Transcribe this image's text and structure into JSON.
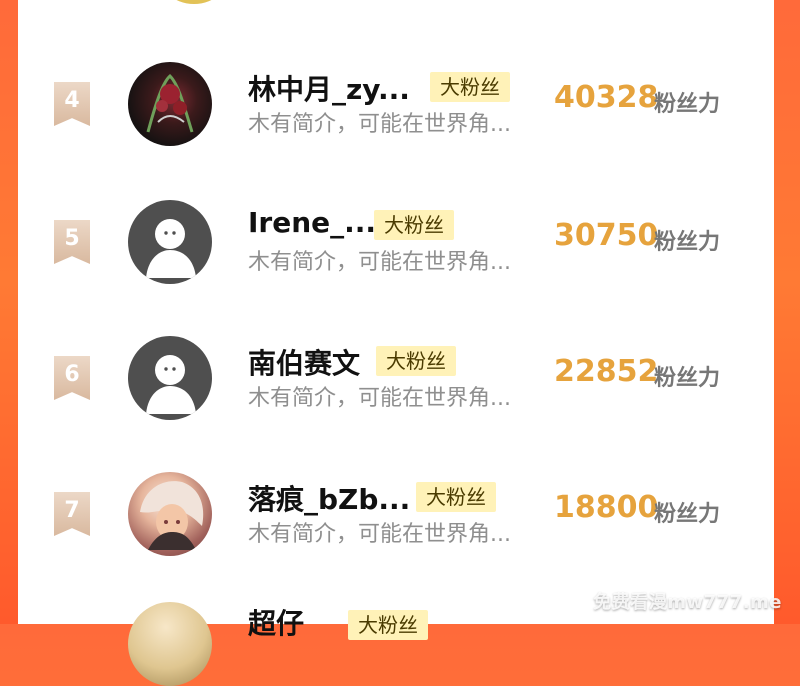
{
  "list": {
    "rows": [
      {
        "rank": "4",
        "name": "林中月_zy...",
        "badge": "大粉丝",
        "desc": "木有简介，可能在世界角...",
        "score": "40328",
        "unit": "粉丝力",
        "avatar_icon": "custom-avatar"
      },
      {
        "rank": "5",
        "name": "Irene_...",
        "badge": "大粉丝",
        "desc": "木有简介，可能在世界角...",
        "score": "30750",
        "unit": "粉丝力",
        "avatar_icon": "default-avatar-icon"
      },
      {
        "rank": "6",
        "name": "南伯赛文",
        "badge": "大粉丝",
        "desc": "木有简介，可能在世界角...",
        "score": "22852",
        "unit": "粉丝力",
        "avatar_icon": "default-avatar-icon"
      },
      {
        "rank": "7",
        "name": "落痕_bZb...",
        "badge": "大粉丝",
        "desc": "木有简介，可能在世界角...",
        "score": "18800",
        "unit": "粉丝力",
        "avatar_icon": "custom-avatar"
      }
    ],
    "next_peek": {
      "name": "超仔",
      "badge": "大粉丝"
    }
  },
  "watermark": "免费看漫mw777.me",
  "colors": {
    "background_orange": "#ff6a3a",
    "badge_yellow": "#fff2b8",
    "score_gold": "#e6a33d",
    "rank_tan": "#d9b99f"
  }
}
